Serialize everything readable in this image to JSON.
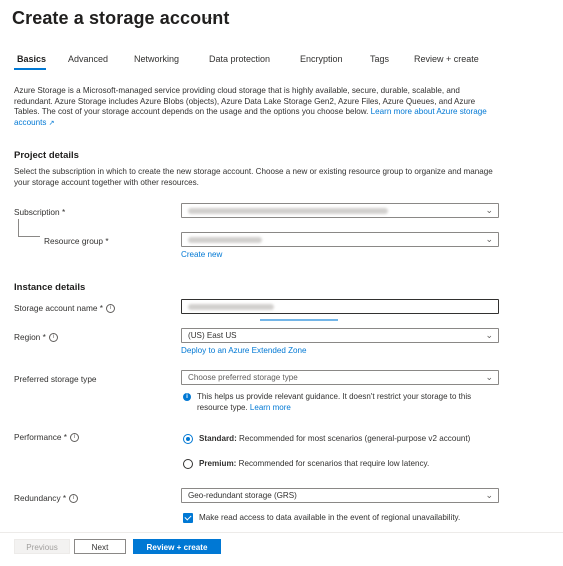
{
  "header": {
    "title": "Create a storage account",
    "more": "···"
  },
  "tabs": [
    {
      "label": "Basics",
      "active": true
    },
    {
      "label": "Advanced"
    },
    {
      "label": "Networking"
    },
    {
      "label": "Data protection"
    },
    {
      "label": "Encryption"
    },
    {
      "label": "Tags"
    },
    {
      "label": "Review + create"
    }
  ],
  "intro": {
    "text": "Azure Storage is a Microsoft-managed service providing cloud storage that is highly available, secure, durable, scalable, and redundant. Azure Storage includes Azure Blobs (objects), Azure Data Lake Storage Gen2, Azure Files, Azure Queues, and Azure Tables. The cost of your storage account depends on the usage and the options you choose below. ",
    "link": "Learn more about Azure storage accounts"
  },
  "project": {
    "heading": "Project details",
    "description": "Select the subscription in which to create the new storage account. Choose a new or existing resource group to organize and manage your storage account together with other resources.",
    "subscription_label": "Subscription *",
    "resource_group_label": "Resource group *",
    "create_new": "Create new"
  },
  "instance": {
    "heading": "Instance details",
    "name_label": "Storage account name *",
    "region_label": "Region *",
    "region_value": "(US) East US",
    "extended_zone_link": "Deploy to an Azure Extended Zone",
    "storage_type_label": "Preferred storage type",
    "storage_type_placeholder": "Choose preferred storage type",
    "storage_type_info": "This helps us provide relevant guidance. It doesn't restrict your storage to this resource type. ",
    "storage_type_info_link": "Learn more",
    "performance_label": "Performance *",
    "perf_standard_bold": "Standard:",
    "perf_standard_text": " Recommended for most scenarios (general-purpose v2 account)",
    "perf_premium_bold": "Premium:",
    "perf_premium_text": " Recommended for scenarios that require low latency.",
    "redundancy_label": "Redundancy *",
    "redundancy_value": "Geo-redundant storage (GRS)",
    "read_access_text": "Make read access to data available in the event of regional unavailability."
  },
  "footer": {
    "previous": "Previous",
    "next": "Next",
    "review": "Review + create"
  },
  "icons": {
    "chevron": "chevron-down-icon",
    "info": "info-icon",
    "external": "external-link-icon"
  },
  "colors": {
    "accent": "#0078d4",
    "text": "#323130",
    "border": "#8a8886"
  }
}
